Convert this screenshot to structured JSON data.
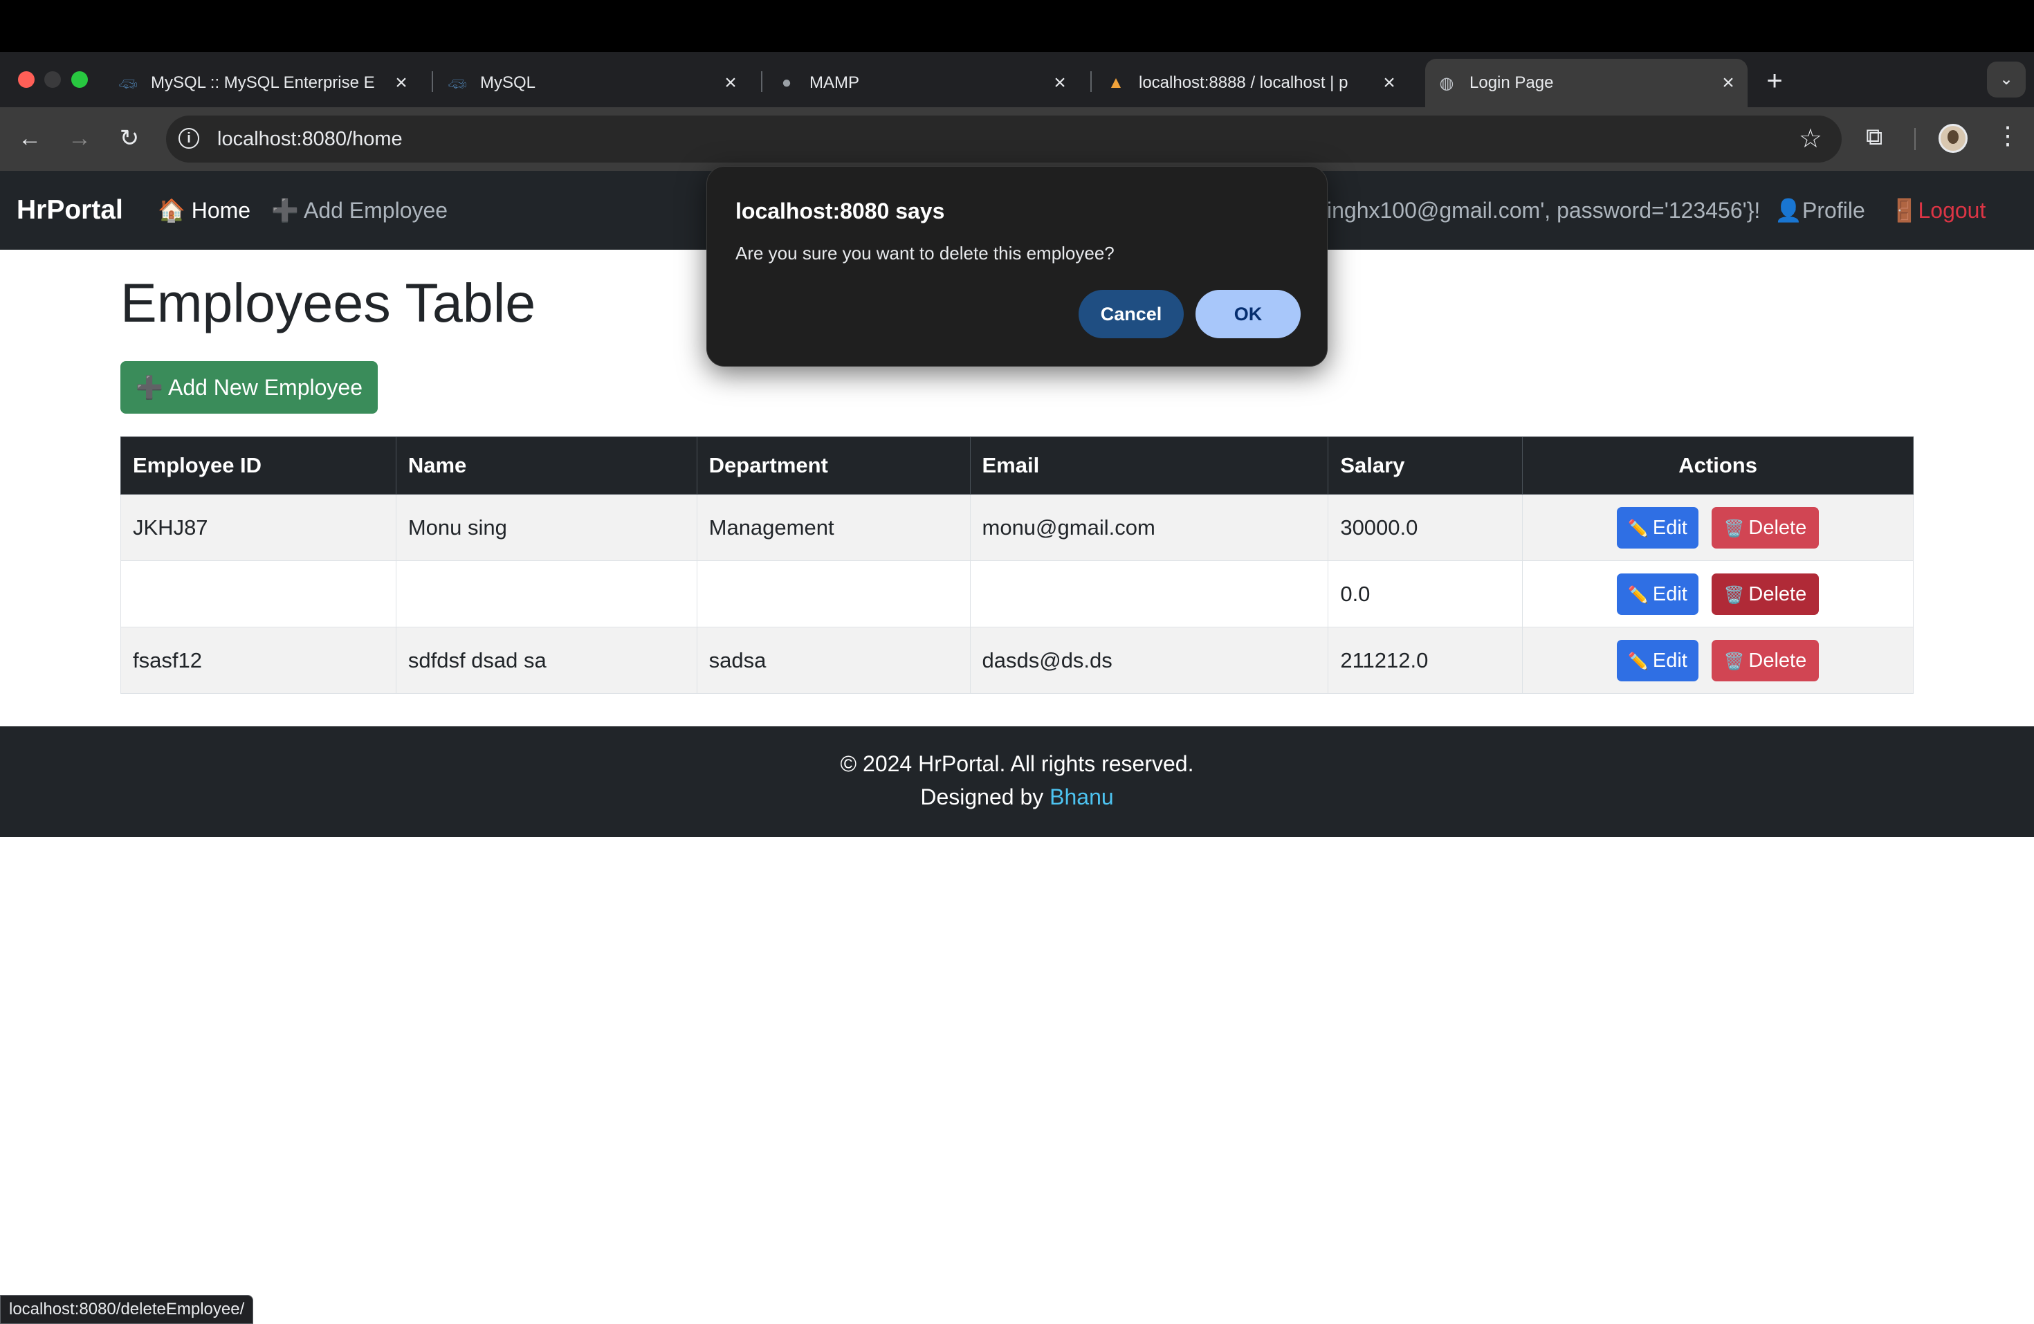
{
  "browser": {
    "tabs": [
      {
        "title": "MySQL :: MySQL Enterprise E",
        "icon": "mysql-dolphin-icon"
      },
      {
        "title": "MySQL",
        "icon": "mysql-dolphin-icon"
      },
      {
        "title": "MAMP",
        "icon": "mamp-elephant-icon"
      },
      {
        "title": "localhost:8888 / localhost | p",
        "icon": "phpmyadmin-icon"
      },
      {
        "title": "Login Page",
        "icon": "globe-icon"
      }
    ],
    "active_tab": 4,
    "url": "localhost:8080/home",
    "status_url": "localhost:8080/deleteEmployee/"
  },
  "navbar": {
    "brand": "HrPortal",
    "home": "Home",
    "add_employee": "Add Employee",
    "user_text": "inghx100@gmail.com', password='123456'}!",
    "profile": "Profile",
    "logout": "Logout"
  },
  "main": {
    "title": "Employees Table",
    "add_button": "Add New Employee",
    "columns": [
      "Employee ID",
      "Name",
      "Department",
      "Email",
      "Salary",
      "Actions"
    ],
    "rows": [
      {
        "id": "JKHJ87",
        "name": "Monu sing",
        "department": "Management",
        "email": "monu@gmail.com",
        "salary": "30000.0"
      },
      {
        "id": "",
        "name": "",
        "department": "",
        "email": "",
        "salary": "0.0"
      },
      {
        "id": "fsasf12",
        "name": "sdfdsf dsad sa",
        "department": "sadsa",
        "email": "dasds@ds.ds",
        "salary": "211212.0"
      }
    ],
    "edit_label": "Edit",
    "delete_label": "Delete"
  },
  "footer": {
    "copyright": "© 2024 HrPortal. All rights reserved.",
    "designed_by": "Designed by ",
    "author": "Bhanu"
  },
  "dialog": {
    "title": "localhost:8080 says",
    "message": "Are you sure you want to delete this employee?",
    "cancel": "Cancel",
    "ok": "OK"
  },
  "colors": {
    "navbar_bg": "#212529",
    "add_button": "#3a8c5a",
    "edit_button": "#2f6fe4",
    "delete_button": "#d14553",
    "logout": "#dc3545",
    "author_link": "#4dc3f0",
    "dialog_ok": "#a8c7fa",
    "dialog_cancel": "#1f4e82"
  }
}
